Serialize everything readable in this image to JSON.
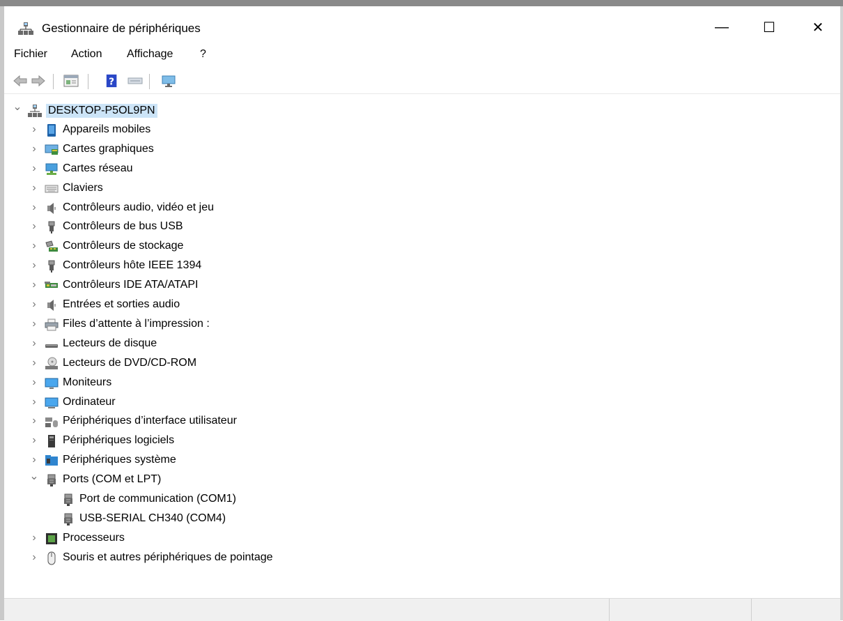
{
  "window": {
    "title": "Gestionnaire de périphériques",
    "controls": {
      "minimize": "—",
      "maximize": "☐",
      "close": "✕"
    }
  },
  "menu": [
    "Fichier",
    "Action",
    "Affichage",
    "?"
  ],
  "toolbar": {
    "icons": [
      "back-arrow-icon",
      "forward-arrow-icon",
      "properties-icon",
      "help-icon",
      "update-driver-icon",
      "scan-hardware-icon"
    ]
  },
  "tree": {
    "root": "DESKTOP-P5OL9PN",
    "categories": [
      {
        "label": "Appareils mobiles",
        "icon": "mobile-device-icon",
        "expanded": false
      },
      {
        "label": "Cartes graphiques",
        "icon": "display-adapter-icon",
        "expanded": false
      },
      {
        "label": "Cartes réseau",
        "icon": "network-adapter-icon",
        "expanded": false
      },
      {
        "label": "Claviers",
        "icon": "keyboard-icon",
        "expanded": false
      },
      {
        "label": "Contrôleurs audio, vidéo et jeu",
        "icon": "speaker-icon",
        "expanded": false
      },
      {
        "label": "Contrôleurs de bus USB",
        "icon": "usb-icon",
        "expanded": false
      },
      {
        "label": "Contrôleurs de stockage",
        "icon": "storage-controller-icon",
        "expanded": false
      },
      {
        "label": "Contrôleurs hôte IEEE 1394",
        "icon": "firewire-icon",
        "expanded": false
      },
      {
        "label": "Contrôleurs IDE ATA/ATAPI",
        "icon": "ide-controller-icon",
        "expanded": false
      },
      {
        "label": "Entrées et sorties audio",
        "icon": "speaker-icon",
        "expanded": false
      },
      {
        "label": "Files d’attente à l’impression :",
        "icon": "printer-icon",
        "expanded": false
      },
      {
        "label": "Lecteurs de disque",
        "icon": "disk-drive-icon",
        "expanded": false
      },
      {
        "label": "Lecteurs de DVD/CD-ROM",
        "icon": "dvd-drive-icon",
        "expanded": false
      },
      {
        "label": "Moniteurs",
        "icon": "monitor-icon",
        "expanded": false
      },
      {
        "label": "Ordinateur",
        "icon": "computer-icon",
        "expanded": false
      },
      {
        "label": "Périphériques d’interface utilisateur",
        "icon": "hid-icon",
        "expanded": false
      },
      {
        "label": "Périphériques logiciels",
        "icon": "software-device-icon",
        "expanded": false
      },
      {
        "label": "Périphériques système",
        "icon": "system-device-icon",
        "expanded": false
      },
      {
        "label": "Ports (COM et LPT)",
        "icon": "port-icon",
        "expanded": true,
        "children": [
          "Port de communication (COM1)",
          "USB-SERIAL CH340 (COM4)"
        ]
      },
      {
        "label": "Processeurs",
        "icon": "processor-icon",
        "expanded": false
      },
      {
        "label": "Souris et autres périphériques de pointage",
        "icon": "mouse-icon",
        "expanded": false
      }
    ]
  },
  "colors": {
    "selection": "#cce4f7",
    "monitor_blue": "#2f8fd8",
    "chevron": "#777777"
  }
}
